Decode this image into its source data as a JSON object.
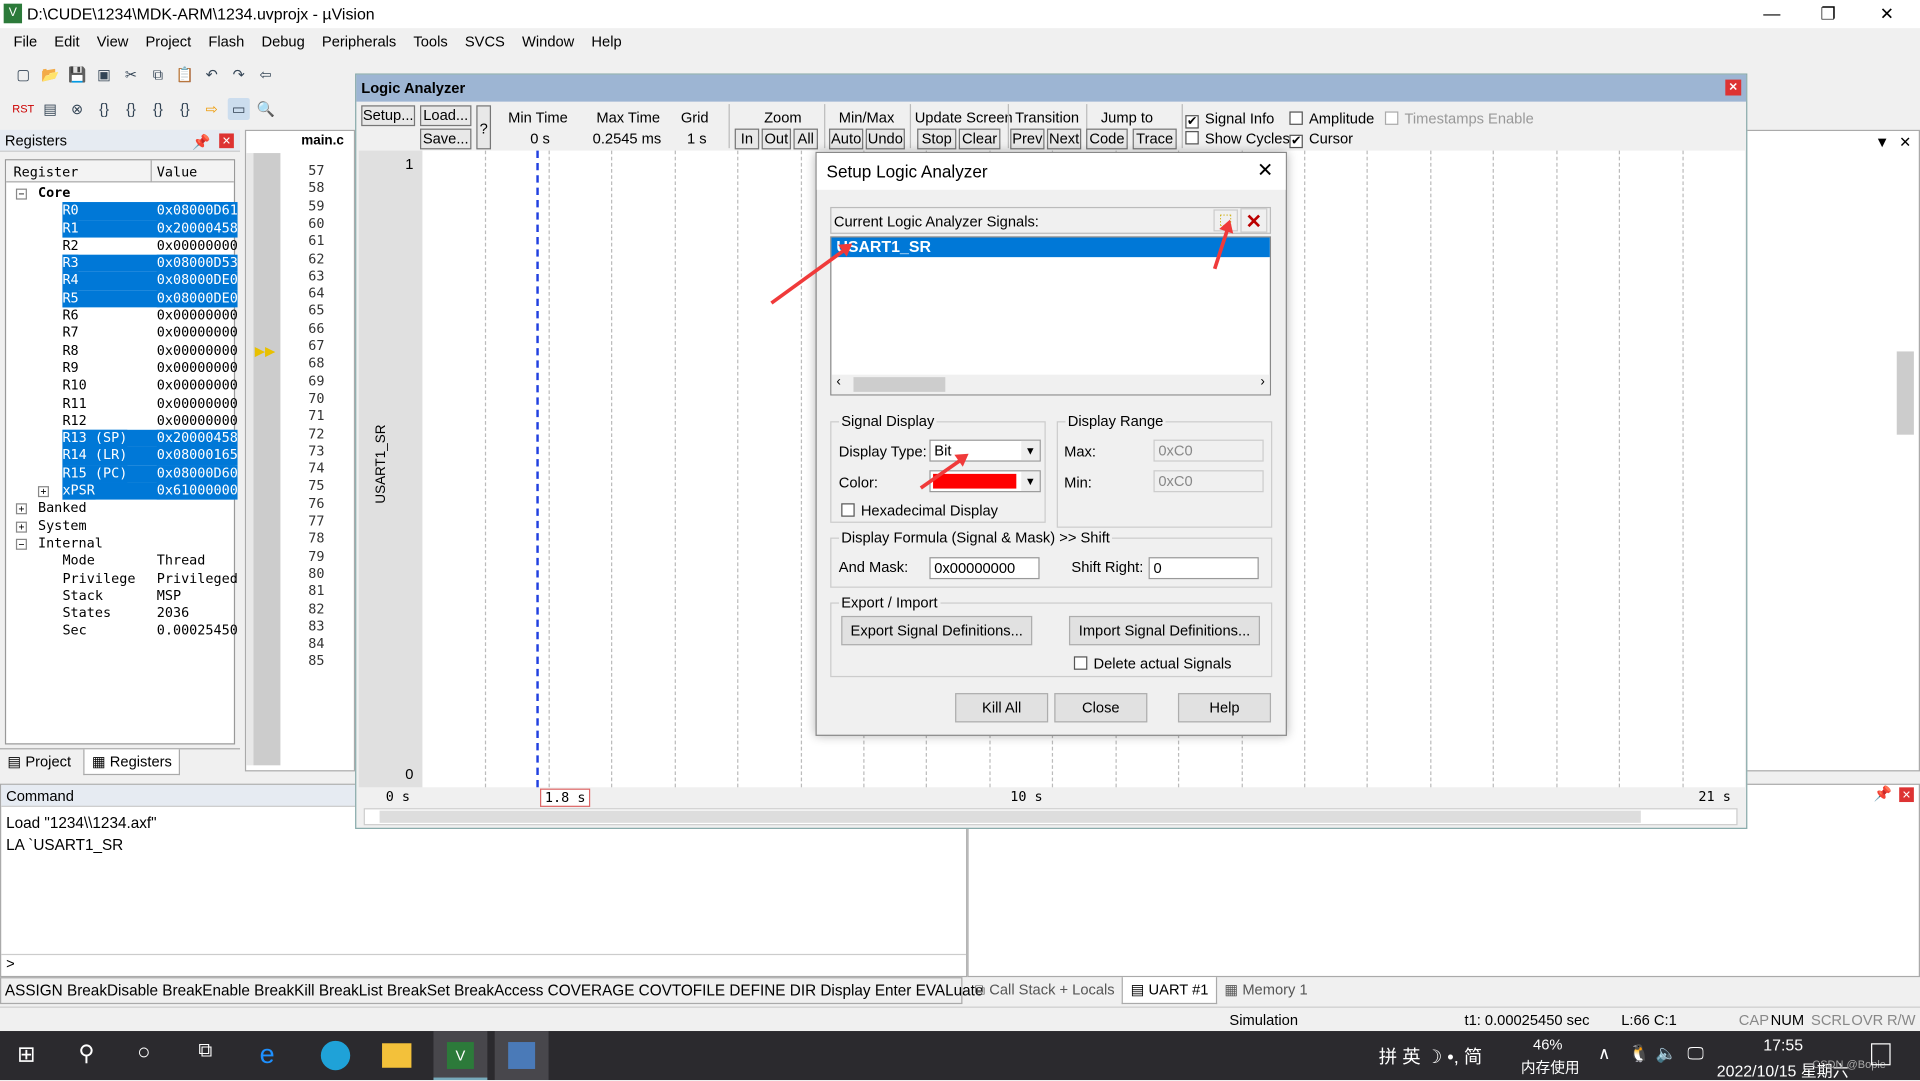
{
  "window": {
    "title": "D:\\CUDE\\1234\\MDK-ARM\\1234.uvprojx - µVision",
    "minimize": "—",
    "maximize": "❐",
    "close": "✕"
  },
  "menu": [
    "File",
    "Edit",
    "View",
    "Project",
    "Flash",
    "Debug",
    "Peripherals",
    "Tools",
    "SVCS",
    "Window",
    "Help"
  ],
  "registers": {
    "title": "Registers",
    "col_register": "Register",
    "col_value": "Value",
    "core_label": "Core",
    "rows": [
      {
        "name": "R0",
        "value": "0x08000D61",
        "selected": true
      },
      {
        "name": "R1",
        "value": "0x20000458",
        "selected": true
      },
      {
        "name": "R2",
        "value": "0x00000000",
        "selected": false
      },
      {
        "name": "R3",
        "value": "0x08000D53",
        "selected": true
      },
      {
        "name": "R4",
        "value": "0x08000DE0",
        "selected": true
      },
      {
        "name": "R5",
        "value": "0x08000DE0",
        "selected": true
      },
      {
        "name": "R6",
        "value": "0x00000000",
        "selected": false
      },
      {
        "name": "R7",
        "value": "0x00000000",
        "selected": false
      },
      {
        "name": "R8",
        "value": "0x00000000",
        "selected": false
      },
      {
        "name": "R9",
        "value": "0x00000000",
        "selected": false
      },
      {
        "name": "R10",
        "value": "0x00000000",
        "selected": false
      },
      {
        "name": "R11",
        "value": "0x00000000",
        "selected": false
      },
      {
        "name": "R12",
        "value": "0x00000000",
        "selected": false
      },
      {
        "name": "R13 (SP)",
        "value": "0x20000458",
        "selected": true
      },
      {
        "name": "R14 (LR)",
        "value": "0x08000165",
        "selected": true
      },
      {
        "name": "R15 (PC)",
        "value": "0x08000D60",
        "selected": true
      },
      {
        "name": "xPSR",
        "value": "0x61000000",
        "selected": true
      }
    ],
    "groups": [
      "Banked",
      "System",
      "Internal"
    ],
    "internal": [
      {
        "name": "Mode",
        "value": "Thread"
      },
      {
        "name": "Privilege",
        "value": "Privileged"
      },
      {
        "name": "Stack",
        "value": "MSP"
      },
      {
        "name": "States",
        "value": "2036"
      },
      {
        "name": "Sec",
        "value": "0.00025450"
      }
    ],
    "tabs": [
      "Project",
      "Registers"
    ]
  },
  "editor": {
    "tab": "main.c",
    "lines": [
      "57",
      "58",
      "59",
      "60",
      "61",
      "62",
      "63",
      "64",
      "65",
      "66",
      "67",
      "68",
      "69",
      "70",
      "71",
      "72",
      "73",
      "74",
      "75",
      "76",
      "77",
      "78",
      "79",
      "80",
      "81",
      "82",
      "83",
      "84",
      "85"
    ]
  },
  "logic_analyzer": {
    "title": "Logic Analyzer",
    "setup": "Setup...",
    "load": "Load...",
    "save": "Save...",
    "help": "?",
    "min_time_label": "Min Time",
    "min_time": "0 s",
    "max_time_label": "Max Time",
    "max_time": "0.2545 ms",
    "grid_label": "Grid",
    "grid": "1 s",
    "zoom_label": "Zoom",
    "zoom_in": "In",
    "zoom_out": "Out",
    "zoom_all": "All",
    "minmax_label": "Min/Max",
    "auto": "Auto",
    "undo": "Undo",
    "update_label": "Update Screen",
    "stop": "Stop",
    "clear": "Clear",
    "transition_label": "Transition",
    "prev": "Prev",
    "next": "Next",
    "jump_label": "Jump to",
    "code": "Code",
    "trace": "Trace",
    "signal_info": {
      "label": "Signal Info",
      "checked": true
    },
    "amplitude": {
      "label": "Amplitude",
      "checked": false
    },
    "timestamps": {
      "label": "Timestamps Enable",
      "checked": false
    },
    "show_cycles": {
      "label": "Show Cycles",
      "checked": false
    },
    "cursor": {
      "label": "Cursor",
      "checked": true
    },
    "signal_name": "USART1_SR",
    "y_high": "1",
    "y_low": "0",
    "t_start": "0 s",
    "t_mid": "10 s",
    "t_end": "21 s",
    "cursor_time": "1.8 s"
  },
  "dialog": {
    "title": "Setup Logic Analyzer",
    "signals_label": "Current Logic Analyzer Signals:",
    "signals": [
      "USART1_SR"
    ],
    "signal_display": "Signal Display",
    "display_type_label": "Display Type:",
    "display_type": "Bit",
    "color_label": "Color:",
    "color": "#ff0000",
    "hex_display": "Hexadecimal Display",
    "display_range": "Display Range",
    "max_label": "Max:",
    "max": "0xC0",
    "min_label": "Min:",
    "min": "0xC0",
    "formula": "Display Formula (Signal & Mask) >> Shift",
    "and_mask_label": "And Mask:",
    "and_mask": "0x00000000",
    "shift_label": "Shift Right:",
    "shift": "0",
    "export_import": "Export / Import",
    "export": "Export Signal Definitions...",
    "import": "Import Signal Definitions...",
    "delete_actual": "Delete actual Signals",
    "kill_all": "Kill All",
    "close": "Close",
    "help": "Help"
  },
  "command": {
    "title": "Command",
    "lines": [
      "Load \"1234\\\\1234.axf\"",
      "LA `USART1_SR"
    ],
    "prompt": ">",
    "hint": "ASSIGN BreakDisable BreakEnable BreakKill BreakList BreakSet BreakAccess COVERAGE COVTOFILE DEFINE DIR Display Enter EVALuate"
  },
  "bottom_tabs": [
    "Call Stack + Locals",
    "UART #1",
    "Memory 1"
  ],
  "status": {
    "mode": "Simulation",
    "t1": "t1: 0.00025450 sec",
    "pos": "L:66 C:1",
    "cap": "CAP",
    "num": "NUM",
    "scrl": "SCRL",
    "ovr": "OVR",
    "rw": "R/W"
  },
  "taskbar": {
    "ime": "拼 英 ☽ •, 简",
    "mem_pct": "46%",
    "mem_label": "内存使用",
    "time": "17:55",
    "date": "2022/10/15 星期六",
    "watermark": "CSDN @Bople"
  }
}
